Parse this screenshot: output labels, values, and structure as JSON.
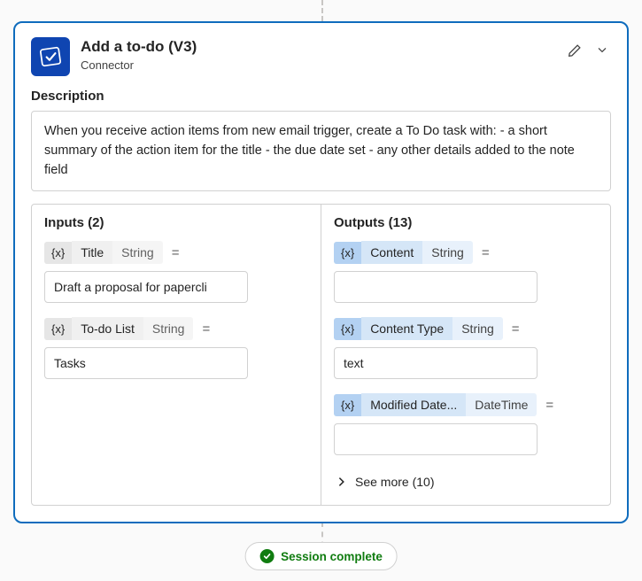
{
  "header": {
    "title": "Add a to-do (V3)",
    "subtitle": "Connector"
  },
  "description": {
    "heading": "Description",
    "text": "When you receive action items from new email trigger, create a To Do task with: - a short summary of the action item for the title - the due date set - any other details added to the note field"
  },
  "inputs": {
    "heading": "Inputs (2)",
    "params": [
      {
        "tag": "{x}",
        "name": "Title",
        "type": "String",
        "value": "Draft a proposal for papercli"
      },
      {
        "tag": "{x}",
        "name": "To-do List",
        "type": "String",
        "value": "Tasks"
      }
    ]
  },
  "outputs": {
    "heading": "Outputs (13)",
    "params": [
      {
        "tag": "{x}",
        "name": "Content",
        "type": "String",
        "value": ""
      },
      {
        "tag": "{x}",
        "name": "Content Type",
        "type": "String",
        "value": "text"
      },
      {
        "tag": "{x}",
        "name": "Modified Date...",
        "type": "DateTime",
        "value": ""
      }
    ],
    "see_more": "See more (10)"
  },
  "session": {
    "label": "Session complete"
  },
  "equals": "="
}
